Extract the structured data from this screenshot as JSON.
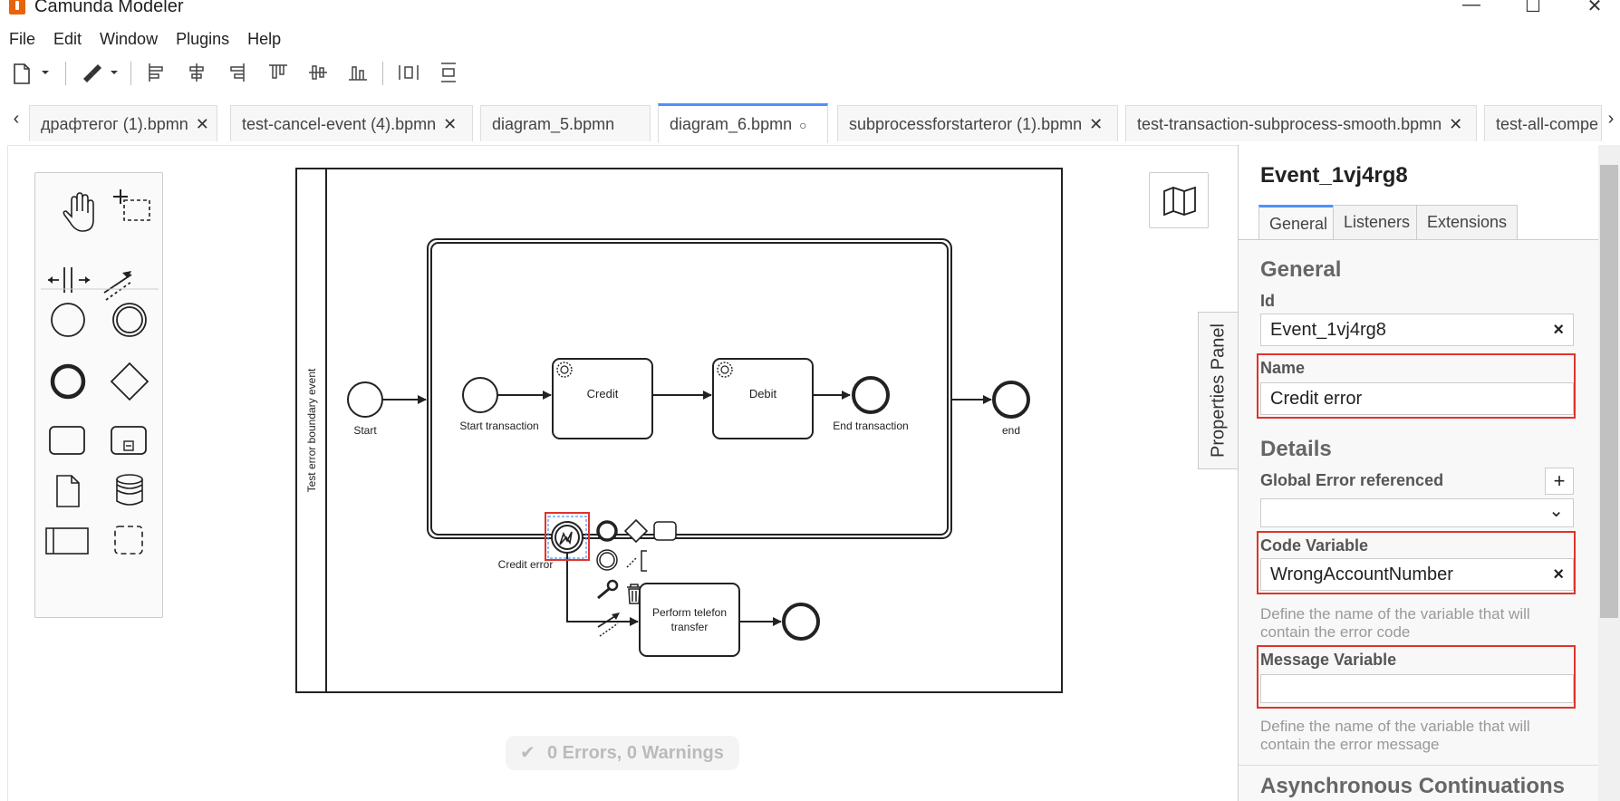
{
  "window": {
    "title": "Camunda Modeler"
  },
  "menu": [
    "File",
    "Edit",
    "Window",
    "Plugins",
    "Help"
  ],
  "toolbar": {
    "buttons": [
      "new-file",
      "paint-format",
      "align-left",
      "align-center",
      "align-right",
      "align-top",
      "align-middle",
      "align-bottom",
      "distribute-horizontal",
      "distribute-vertical"
    ]
  },
  "tabs": [
    {
      "label": "драфтегог (1).bpmn",
      "active": false,
      "dirty": false
    },
    {
      "label": "test-cancel-event (4).bpmn",
      "active": false,
      "dirty": false
    },
    {
      "label": "diagram_5.bpmn",
      "active": false,
      "dirty": false
    },
    {
      "label": "diagram_6.bpmn",
      "active": true,
      "dirty": true
    },
    {
      "label": "subprocessforstarteror (1).bpmn",
      "active": false,
      "dirty": false
    },
    {
      "label": "test-transaction-subprocess-smooth.bpmn",
      "active": false,
      "dirty": false
    },
    {
      "label": "test-all-compe",
      "active": false,
      "dirty": false
    }
  ],
  "diagram": {
    "pool_label": "Test error boundary event",
    "start_label": "Start",
    "start_transaction_label": "Start transaction",
    "credit_label": "Credit",
    "debit_label": "Debit",
    "end_transaction_label": "End transaction",
    "end_label": "end",
    "boundary_label": "Credit error",
    "telefon_line1": "Perform telefon",
    "telefon_line2": "transfer"
  },
  "status": {
    "text": "0 Errors, 0 Warnings"
  },
  "properties": {
    "toggle_label": "Properties Panel",
    "element_id": "Event_1vj4rg8",
    "tabs": [
      "General",
      "Listeners",
      "Extensions"
    ],
    "general_title": "General",
    "id_label": "Id",
    "id_value": "Event_1vj4rg8",
    "name_label": "Name",
    "name_value": "Credit error",
    "details_title": "Details",
    "global_error_label": "Global Error referenced",
    "global_error_value": "",
    "code_label": "Code Variable",
    "code_value": "WrongAccountNumber",
    "code_help": "Define the name of the variable that will contain the error code",
    "message_label": "Message Variable",
    "message_value": "",
    "message_help": "Define the name of the variable that will contain the error message",
    "async_title": "Asynchronous Continuations",
    "clear_symbol": "×",
    "add_symbol": "+",
    "dropdown_symbol": "⌄"
  },
  "colors": {
    "accent": "#4d90fe",
    "highlight": "#e0342a",
    "brand": "#e8630a"
  }
}
